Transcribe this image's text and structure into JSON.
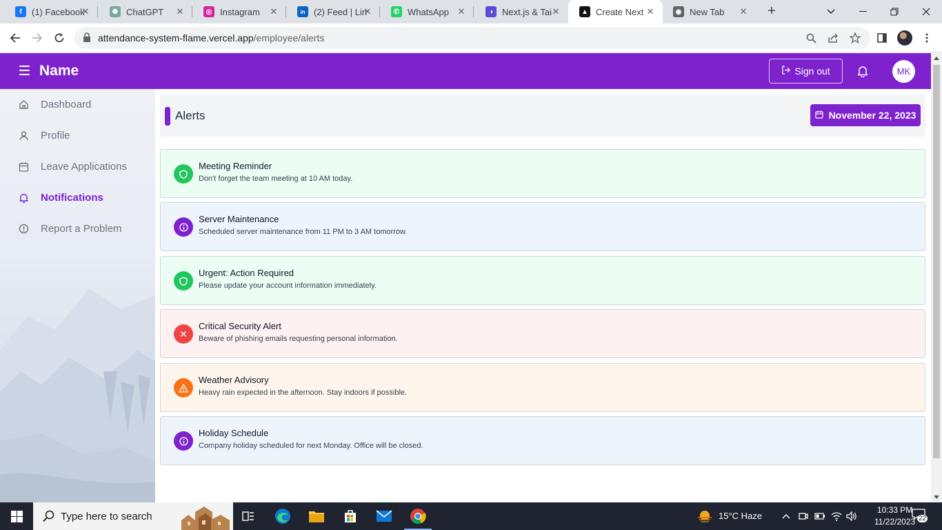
{
  "browser": {
    "tabs": [
      {
        "title": "(1) Facebook",
        "icon": "facebook-icon",
        "color": "#1877f2",
        "glyph": "f"
      },
      {
        "title": "ChatGPT",
        "icon": "chatgpt-icon",
        "color": "#74aa9c",
        "glyph": "✺"
      },
      {
        "title": "Instagram",
        "icon": "instagram-icon",
        "color": "#d6249f",
        "glyph": "◎"
      },
      {
        "title": "(2) Feed | Lin",
        "icon": "linkedin-icon",
        "color": "#0a66c2",
        "glyph": "in"
      },
      {
        "title": "WhatsApp",
        "icon": "whatsapp-icon",
        "color": "#25d366",
        "glyph": "✆"
      },
      {
        "title": "Next.js & Tai",
        "icon": "nextjs-tailwind-icon",
        "color": "#5b4bd6",
        "glyph": "◑"
      },
      {
        "title": "Create Next",
        "icon": "vercel-icon",
        "color": "#111111",
        "glyph": "▲",
        "active": true
      },
      {
        "title": "New Tab",
        "icon": "chrome-icon",
        "color": "#5f6368",
        "glyph": "◉"
      }
    ],
    "url_host": "attendance-system-flame.vercel.app",
    "url_path": "/employee/alerts"
  },
  "header": {
    "app_name": "Name",
    "signout_label": "Sign out",
    "avatar_initials": "MK",
    "brand_color": "#7e22ce"
  },
  "sidebar": {
    "items": [
      {
        "label": "Dashboard",
        "icon": "home-icon"
      },
      {
        "label": "Profile",
        "icon": "user-icon"
      },
      {
        "label": "Leave Applications",
        "icon": "calendar-icon"
      },
      {
        "label": "Notifications",
        "icon": "bell-icon",
        "active": true
      },
      {
        "label": "Report a Problem",
        "icon": "alert-circle-icon"
      }
    ]
  },
  "main": {
    "title": "Alerts",
    "date_label": "November 22, 2023",
    "alerts": [
      {
        "title": "Meeting Reminder",
        "message": "Don't forget the team meeting at 10 AM today.",
        "type": "success",
        "icon": "shield-icon",
        "icon_color": "#22c55e"
      },
      {
        "title": "Server Maintenance",
        "message": "Scheduled server maintenance from 11 PM to 3 AM tomorrow.",
        "type": "info",
        "icon": "info-icon",
        "icon_color": "#7e22ce"
      },
      {
        "title": "Urgent: Action Required",
        "message": "Please update your account information immediately.",
        "type": "success",
        "icon": "shield-icon",
        "icon_color": "#22c55e"
      },
      {
        "title": "Critical Security Alert",
        "message": "Beware of phishing emails requesting personal information.",
        "type": "error",
        "icon": "close-icon",
        "icon_color": "#ef4444"
      },
      {
        "title": "Weather Advisory",
        "message": "Heavy rain expected in the afternoon. Stay indoors if possible.",
        "type": "warning",
        "icon": "warning-icon",
        "icon_color": "#f97316"
      },
      {
        "title": "Holiday Schedule",
        "message": "Company holiday scheduled for next Monday. Office will be closed.",
        "type": "info",
        "icon": "info-icon",
        "icon_color": "#7e22ce"
      }
    ]
  },
  "taskbar": {
    "search_placeholder": "Type here to search",
    "weather": "15°C  Haze",
    "time": "10:33 PM",
    "date": "11/22/2023",
    "notification_count": "22"
  }
}
